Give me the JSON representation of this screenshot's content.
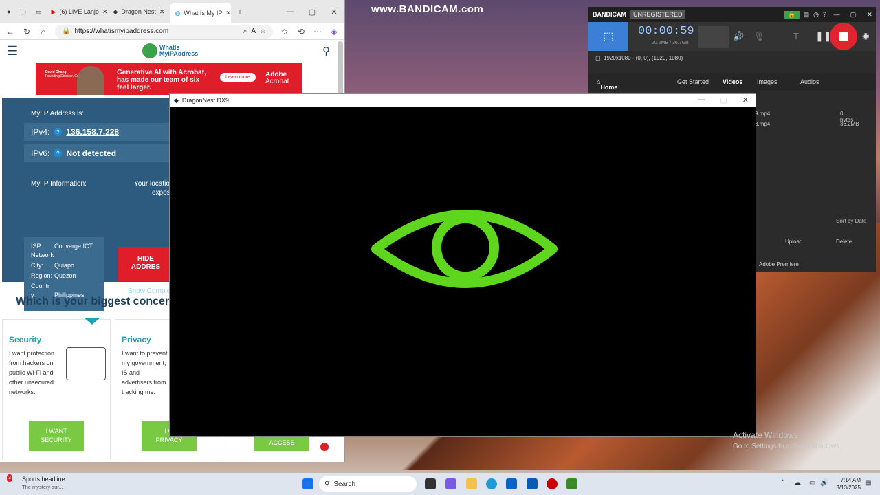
{
  "watermark": "www.BANDICAM.com",
  "browser": {
    "tabs": [
      "(6) LIVE Lanjo",
      "Dragon Nest",
      "What Is My IP"
    ],
    "url": "https://whatismyipaddress.com",
    "site": {
      "logo_line1": "WhatIs",
      "logo_line2": "MyIPAddress",
      "ad": {
        "person": "David Chang",
        "person_title": "Founding Director, Cero Legal",
        "text": "Generative AI with Acrobat, has made our team of six feel larger.",
        "button": "Learn more",
        "brand_line1": "Adobe",
        "brand_line2": "Acrobat"
      },
      "my_ip_label": "My IP Address is:",
      "ipv4_label": "IPv4:",
      "ipv4_value": "136.158.7.228",
      "ipv6_label": "IPv6:",
      "ipv6_value": "Not detected",
      "info_label": "My IP Information:",
      "location_line1": "Your locatio",
      "location_line2": "expos",
      "isp_label": "ISP:",
      "isp_value_1": "Converge ICT",
      "isp_value_2": "Network",
      "city_label": "City:",
      "city_value": "Quiapo",
      "region_label": "Region:",
      "region_value": "Quezon",
      "country_label_1": "Countr",
      "country_label_2": "y:",
      "country_value": "Philippines",
      "hide_line1": "HIDE",
      "hide_line2": "ADDRES",
      "show_complete": "Show Comple",
      "concern_heading": "Which is your biggest concer",
      "cards": [
        {
          "title": "Security",
          "desc": "I want protection from hackers on public Wi-Fi and other unsecured networks.",
          "btn1": "I WANT",
          "btn2": "SECURITY"
        },
        {
          "title": "Privacy",
          "desc": "I want to prevent my government, IS and advertisers from tracking me.",
          "btn1": "I W",
          "btn2": "PRIVACY"
        },
        {
          "btn2": "ACCESS"
        }
      ]
    }
  },
  "bandicam": {
    "brand": "BANDICAM",
    "status": "UNREGISTERED",
    "timer": "00:00:59",
    "size": "20.2MB / 36.7GB",
    "resolution": "1920x1080 - (0, 0), (1920, 1080)",
    "nav": {
      "home": "Home",
      "get_started": "Get Started",
      "videos": "Videos",
      "images": "Images",
      "audios": "Audios"
    },
    "files": [
      {
        "name": "9.mp4",
        "size": "0 bytes"
      },
      {
        "name": "3.mp4",
        "size": "36.2MB"
      }
    ],
    "sort": "Sort by Date",
    "upload": "Upload",
    "delete": "Delete",
    "premiere": "Adobe Premiere"
  },
  "game": {
    "title": "DragonNest DX9",
    "logo_color": "#5fd61e"
  },
  "activate": {
    "title": "Activate Windows",
    "sub": "Go to Settings to activate Windows."
  },
  "taskbar": {
    "news_badge": "3",
    "news_title": "Sports headline",
    "news_sub": "The mystery sur...",
    "search": "Search",
    "time": "7:14 AM",
    "date": "3/13/2025"
  }
}
